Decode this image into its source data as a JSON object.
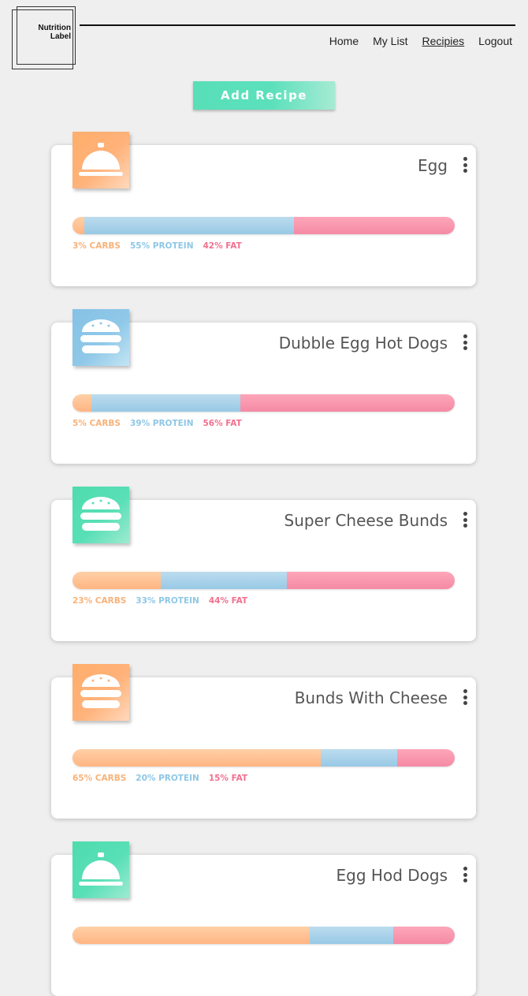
{
  "header": {
    "logo_line1": "Nutrition",
    "logo_line2": "Label",
    "nav": [
      {
        "label": "Home",
        "active": false
      },
      {
        "label": "My List",
        "active": false
      },
      {
        "label": "Recipies",
        "active": true
      },
      {
        "label": "Logout",
        "active": false
      }
    ]
  },
  "add_button_label": "Add Recipe",
  "colors": {
    "carbs": "#f8b27a",
    "protein": "#8ec7e6",
    "fat": "#f2708f",
    "accent_green": "#58dfb8"
  },
  "recipes": [
    {
      "title": "Egg",
      "icon": "food-cloche-icon",
      "icon_color": "orange",
      "carbs": 3,
      "protein": 55,
      "fat": 42,
      "carbs_label": "3% CARBS",
      "protein_label": "55% PROTEIN",
      "fat_label": "42% FAT"
    },
    {
      "title": "Dubble Egg Hot Dogs",
      "icon": "burger-icon",
      "icon_color": "blue",
      "carbs": 5,
      "protein": 39,
      "fat": 56,
      "carbs_label": "5% CARBS",
      "protein_label": "39% PROTEIN",
      "fat_label": "56% FAT"
    },
    {
      "title": "Super Cheese Bunds",
      "icon": "burger-icon",
      "icon_color": "green",
      "carbs": 23,
      "protein": 33,
      "fat": 44,
      "carbs_label": "23% CARBS",
      "protein_label": "33% PROTEIN",
      "fat_label": "44% FAT"
    },
    {
      "title": "Bunds With Cheese",
      "icon": "burger-icon",
      "icon_color": "orange",
      "carbs": 65,
      "protein": 20,
      "fat": 15,
      "carbs_label": "65% CARBS",
      "protein_label": "20% PROTEIN",
      "fat_label": "15% FAT"
    },
    {
      "title": "Egg Hod Dogs",
      "icon": "food-cloche-icon",
      "icon_color": "green",
      "carbs": 62,
      "protein": 22,
      "fat": 16,
      "carbs_label": "",
      "protein_label": "",
      "fat_label": ""
    }
  ]
}
